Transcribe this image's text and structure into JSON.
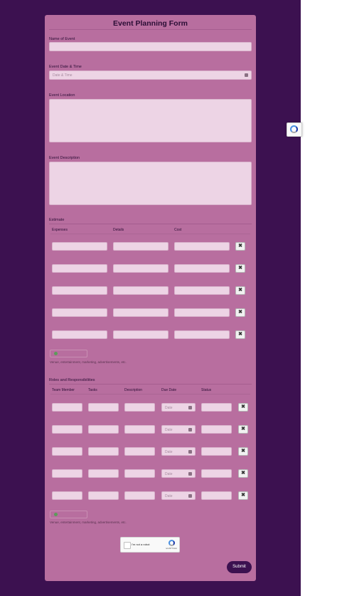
{
  "form": {
    "title": "Event Planning Form",
    "name_label": "Name of Event",
    "datetime_label": "Event Date & Time",
    "datetime_placeholder": "Date & Time",
    "location_label": "Event Location",
    "description_label": "Event Description"
  },
  "estimate": {
    "label": "Estimate",
    "columns": [
      "Expenses",
      "Details",
      "Cost"
    ],
    "row_count": 5,
    "delete_glyph": "✖",
    "hint": "Venue, entertainment, marketing, advertisements, etc."
  },
  "roles": {
    "label": "Roles and Responsibilities",
    "columns": [
      "Team Member",
      "Tasks",
      "Description",
      "Due Date",
      "Status"
    ],
    "due_placeholder": "Date",
    "row_count": 5,
    "delete_glyph": "✖",
    "hint": "Venue, entertainment, marketing, advertisements, etc."
  },
  "captcha": {
    "label": "I'm not a robot",
    "brand": "reCAPTCHA"
  },
  "submit_label": "Submit",
  "colors": {
    "background": "#3c1150",
    "card": "#b86e9f",
    "input": "#edd4e5",
    "button": "#3c1150"
  }
}
